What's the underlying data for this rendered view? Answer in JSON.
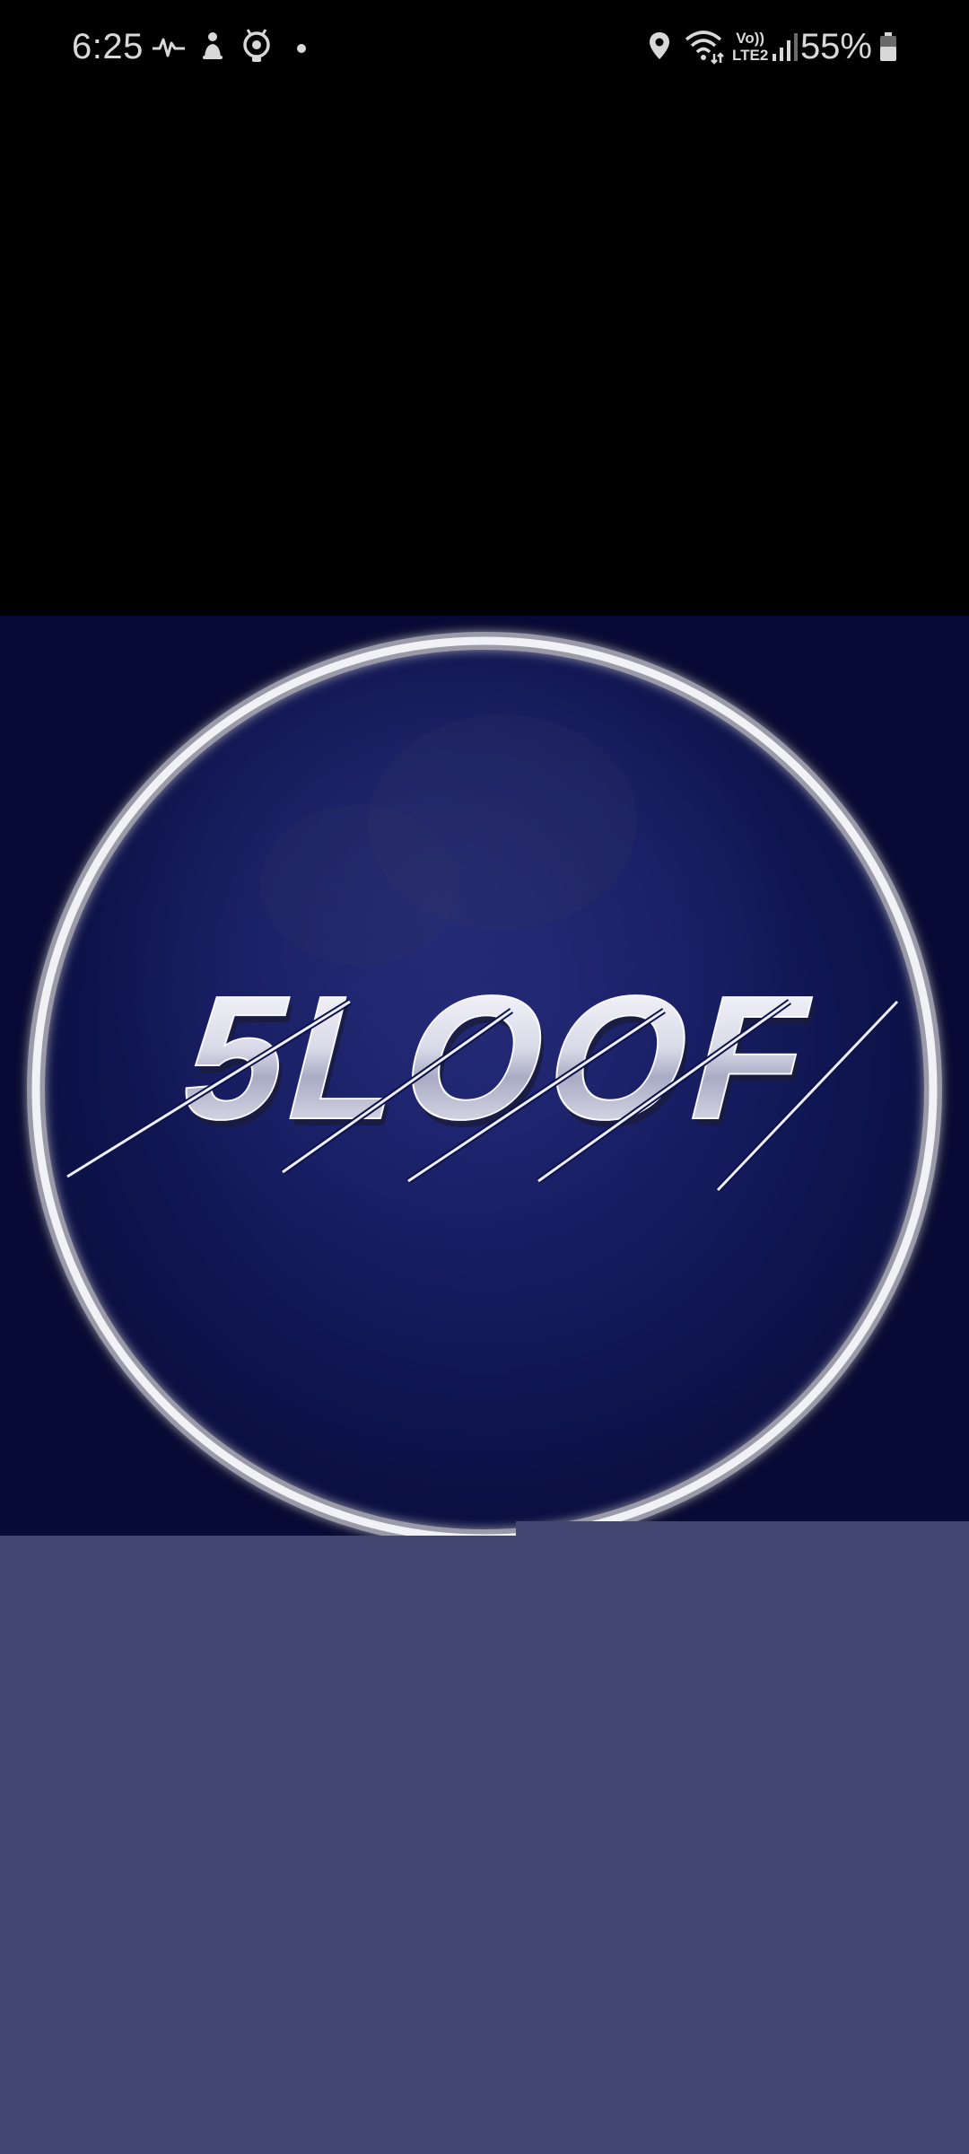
{
  "status_bar": {
    "time": "6:25",
    "network_label_top": "Vo))",
    "network_label_bottom": "LTE2",
    "battery_percent": "55%",
    "icons": [
      "pulse-icon",
      "accessibility-icon",
      "camera-app-icon",
      "dot-icon",
      "location-icon",
      "wifi-icon",
      "signal-icon",
      "battery-icon"
    ]
  },
  "splash": {
    "logo_text": "5LOOF",
    "background_color": "#0b1040",
    "ring_color": "#e8e8ee",
    "panel_color": "#424670"
  }
}
